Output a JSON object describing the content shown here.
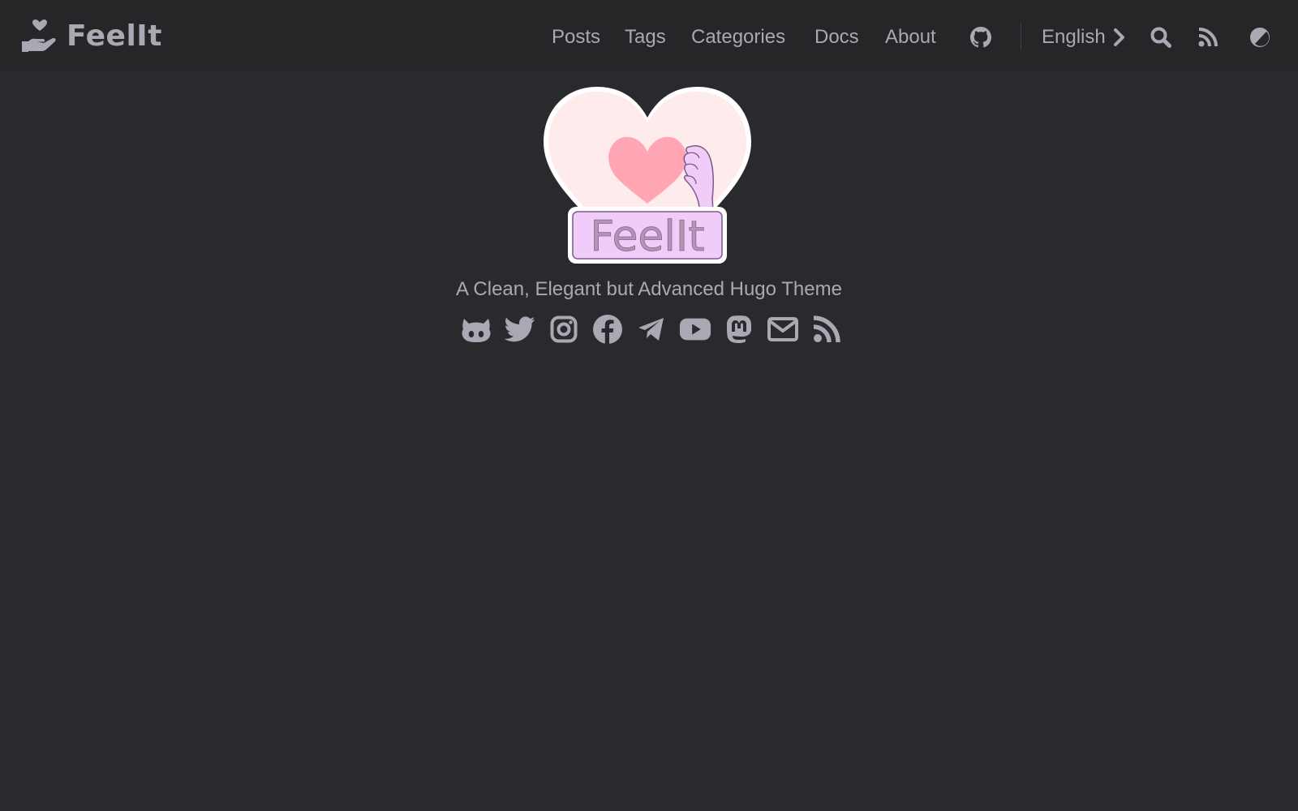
{
  "header": {
    "title": "FeelIt",
    "nav": [
      {
        "label": "Posts"
      },
      {
        "label": "Tags"
      },
      {
        "label": "Categories"
      },
      {
        "label": "Docs"
      },
      {
        "label": "About"
      }
    ],
    "language": "English",
    "icons": [
      "github-icon",
      "chevron-right-icon",
      "search-icon",
      "rss-icon",
      "theme-toggle-icon"
    ]
  },
  "home": {
    "avatar_text": "FeelIt",
    "subtitle": "A Clean, Elegant but Advanced Hugo Theme",
    "social_icons": [
      "github-icon",
      "twitter-icon",
      "instagram-icon",
      "facebook-icon",
      "telegram-icon",
      "youtube-icon",
      "mastodon-icon",
      "email-icon",
      "rss-icon"
    ]
  },
  "colors": {
    "background": "#292a2d",
    "header_background": "#252627",
    "text": "#a9a9b3"
  }
}
